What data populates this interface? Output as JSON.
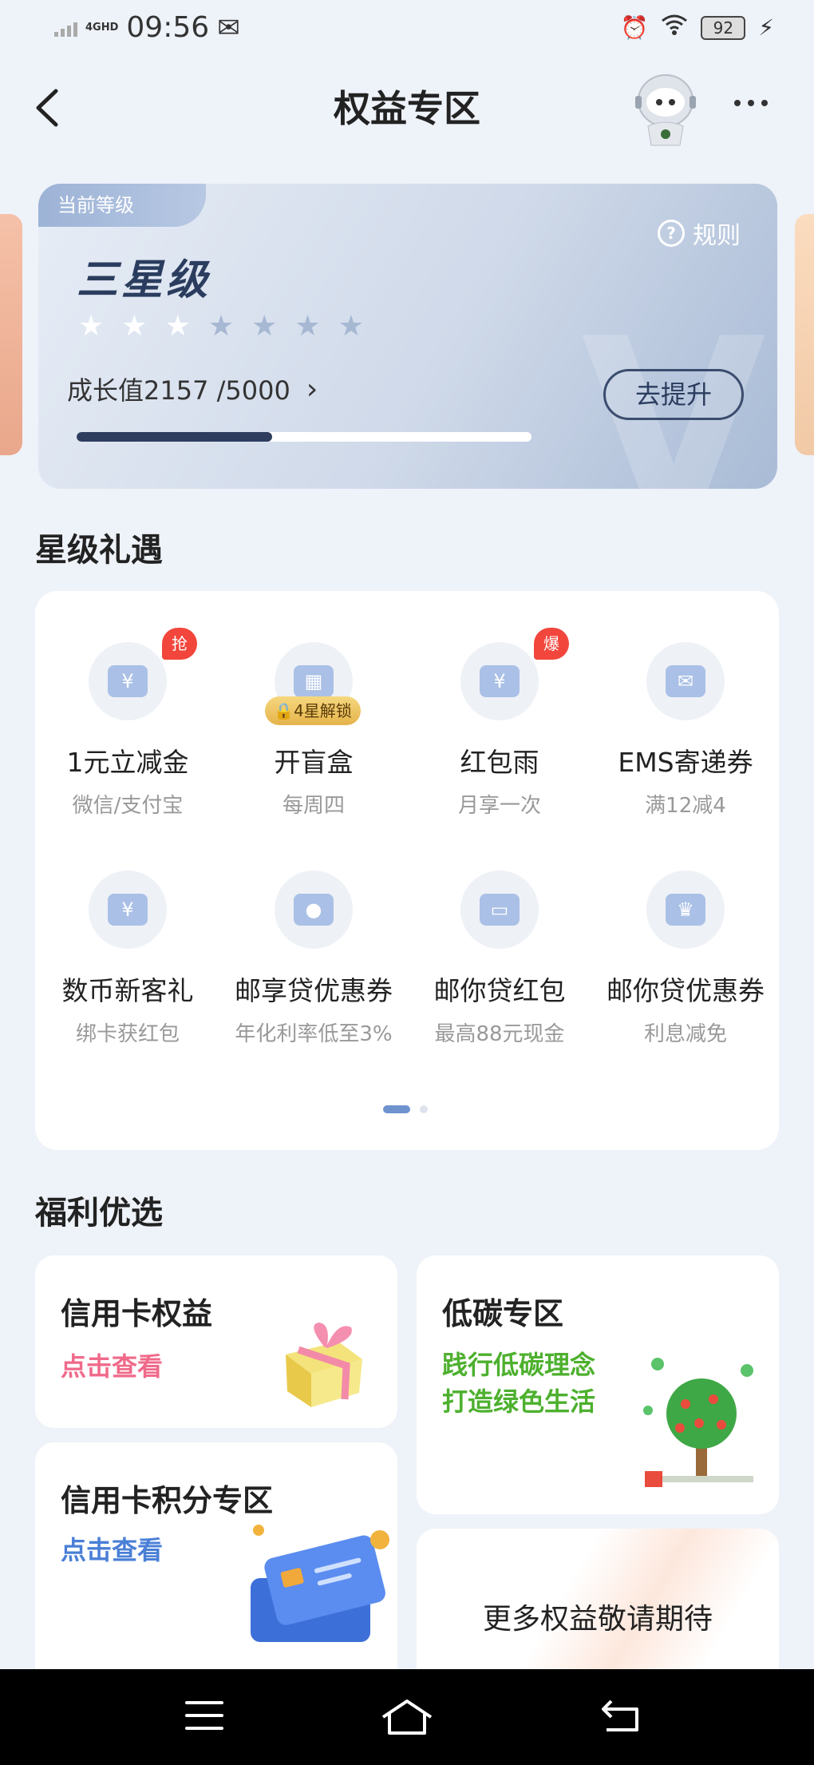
{
  "status_bar": {
    "network": "4GHD",
    "time": "09:56",
    "battery": "92"
  },
  "header": {
    "title": "权益专区"
  },
  "level_card": {
    "tag": "当前等级",
    "rule_label": "规则",
    "level_name": "三星级",
    "stars_filled": 3,
    "stars_total": 7,
    "growth_label": "成长值2157 /5000",
    "growth_fraction": 0.43,
    "upgrade_label": "去提升"
  },
  "star_gifts": {
    "title": "星级礼遇",
    "items": [
      {
        "icon": "coupon-yuan-icon",
        "badge": "抢",
        "label": "1元立减金",
        "sub": "微信/支付宝"
      },
      {
        "icon": "gift-box-icon",
        "lock": "4星解锁",
        "label": "开盲盒",
        "sub": "每周四"
      },
      {
        "icon": "red-packet-icon",
        "badge": "爆",
        "label": "红包雨",
        "sub": "月享一次"
      },
      {
        "icon": "envelope-icon",
        "label": "EMS寄递券",
        "sub": "满12减4"
      },
      {
        "icon": "digital-yuan-icon",
        "label": "数币新客礼",
        "sub": "绑卡获红包"
      },
      {
        "icon": "loan-hand-icon",
        "label": "邮享贷优惠券",
        "sub": "年化利率低至3%"
      },
      {
        "icon": "red-envelope-icon",
        "label": "邮你贷红包",
        "sub": "最高88元现金"
      },
      {
        "icon": "crown-icon",
        "label": "邮你贷优惠券",
        "sub": "利息减免"
      }
    ],
    "page_index": 1,
    "page_count": 2
  },
  "welfare": {
    "title": "福利优选",
    "credit_rights": {
      "title": "信用卡权益",
      "sub": "点击查看",
      "sub_color": "#f06a8a"
    },
    "low_carbon": {
      "title": "低碳专区",
      "line1": "践行低碳理念",
      "line2": "打造绿色生活",
      "sub_color": "#4db02e"
    },
    "points": {
      "title": "信用卡积分专区",
      "sub": "点击查看",
      "sub_color": "#4a7fd6"
    },
    "more": {
      "text": "更多权益敬请期待"
    }
  }
}
